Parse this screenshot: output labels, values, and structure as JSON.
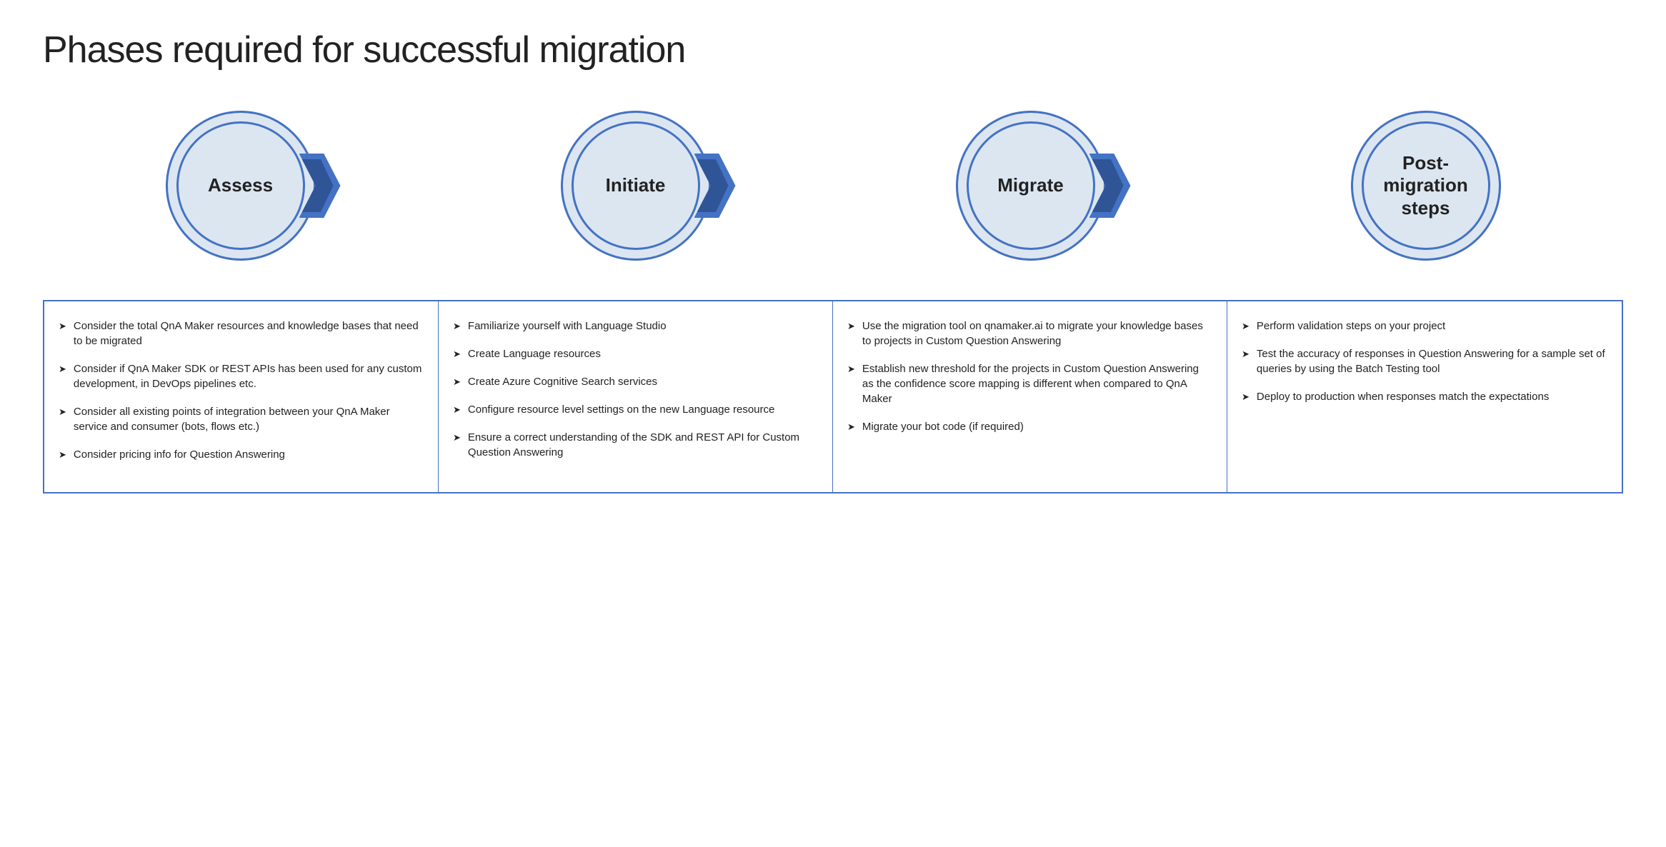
{
  "title": "Phases required for successful migration",
  "phases": [
    {
      "id": "assess",
      "label": "Assess",
      "hasArrow": true
    },
    {
      "id": "initiate",
      "label": "Initiate",
      "hasArrow": true
    },
    {
      "id": "migrate",
      "label": "Migrate",
      "hasArrow": true
    },
    {
      "id": "post-migration",
      "label": "Post-\nmigration\nsteps",
      "hasArrow": false
    }
  ],
  "columns": [
    {
      "id": "assess-col",
      "bullets": [
        "Consider the total QnA Maker resources and knowledge bases that need to be migrated",
        "Consider if QnA Maker SDK or REST APIs has been used for any custom development, in DevOps pipelines etc.",
        "Consider all existing points of integration between your QnA Maker service and consumer (bots, flows etc.)",
        "Consider pricing info for Question Answering"
      ]
    },
    {
      "id": "initiate-col",
      "bullets": [
        "Familiarize yourself with Language Studio",
        "Create Language resources",
        "Create Azure Cognitive Search services",
        "Configure resource level settings on the new Language resource",
        "Ensure a correct understanding of the SDK and REST API for Custom Question Answering"
      ]
    },
    {
      "id": "migrate-col",
      "bullets": [
        "Use the migration tool on qnamaker.ai to migrate your knowledge bases to projects in Custom Question Answering",
        "Establish new threshold for the projects in Custom Question Answering as the confidence score mapping is different when compared to QnA Maker",
        "Migrate your bot code (if required)"
      ]
    },
    {
      "id": "post-migration-col",
      "bullets": [
        "Perform validation steps on your project",
        "Test the accuracy of responses in Question Answering for a sample set of queries by using the Batch Testing tool",
        "Deploy to production when responses match the expectations"
      ]
    }
  ],
  "bullet_arrow_char": "❯"
}
